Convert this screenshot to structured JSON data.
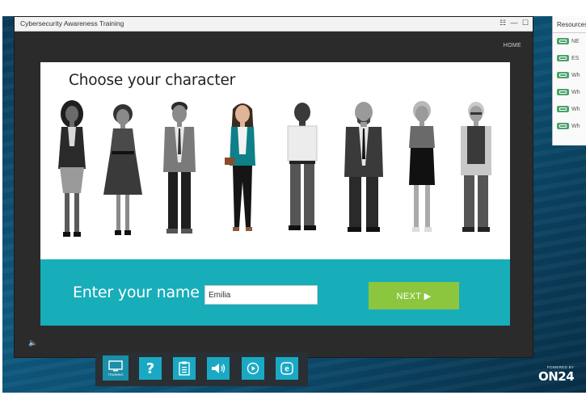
{
  "window": {
    "title": "Cybersecurity Awareness Training",
    "controls": [
      "fullscreen-icon",
      "minimize-icon",
      "maximize-icon"
    ],
    "home_label": "HOME"
  },
  "stage": {
    "heading": "Choose your character",
    "characters": [
      "character-1",
      "character-2",
      "character-3",
      "character-4",
      "character-5",
      "character-6",
      "character-7",
      "character-8"
    ],
    "selected_character": 4,
    "name_label": "Enter your name",
    "name_value": "Emilia",
    "next_label": "NEXT ▶"
  },
  "volume_icon": "volume-icon",
  "dock": {
    "items": [
      {
        "icon": "training-monitor-icon",
        "label": "TRAINING"
      },
      {
        "icon": "help-question-icon",
        "label": ""
      },
      {
        "icon": "clipboard-icon",
        "label": ""
      },
      {
        "icon": "speaker-icon",
        "label": ""
      },
      {
        "icon": "play-circle-icon",
        "label": ""
      },
      {
        "icon": "e-circle-icon",
        "label": ""
      }
    ]
  },
  "resources": {
    "title": "Resources",
    "items": [
      "NE",
      "ES",
      "Wh",
      "Wh",
      "Wh",
      "Wh"
    ]
  },
  "branding": {
    "powered_by": "POWERED BY",
    "name": "ON24"
  },
  "colors": {
    "accent_teal": "#17aeba",
    "next_green": "#8cc63f",
    "dock_blue": "#1aa9c4",
    "resource_green": "#4aa36b"
  }
}
